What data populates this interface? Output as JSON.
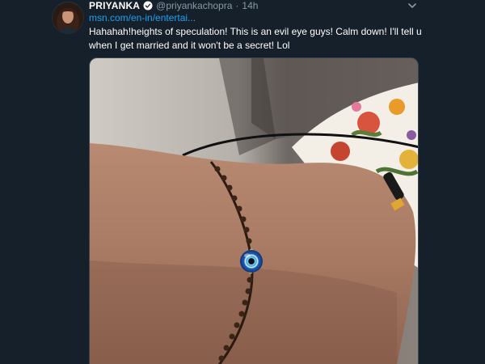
{
  "tweet": {
    "display_name": "PRIYANKA",
    "handle": "@priyankachopra",
    "separator": "·",
    "timestamp": "14h",
    "link_text": "msn.com/en-in/entertai...",
    "body": "Hahahah!heights of speculation! This is an evil eye guys! Calm down! I'll tell u when I get married and it won't be a secret! Lol",
    "verified_icon": "verified-badge-icon",
    "caret_icon": "chevron-down-icon"
  },
  "colors": {
    "background": "#15202b",
    "text": "#ffffff",
    "secondary_text": "#8899a6",
    "link": "#1da1f2",
    "border": "#38444d"
  }
}
